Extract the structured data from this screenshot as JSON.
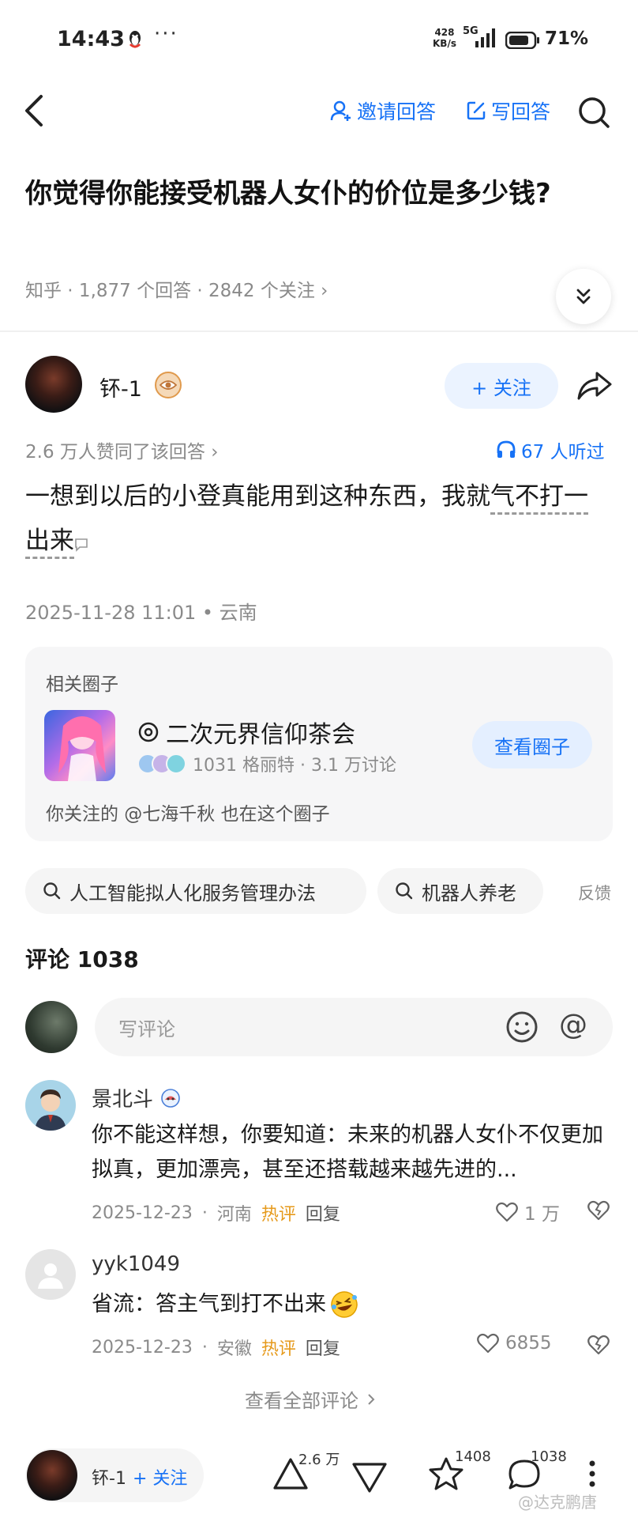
{
  "status_bar": {
    "time": "14:43",
    "more": "···",
    "net_speed_value": "428",
    "net_speed_unit": "KB/s",
    "network": "5G",
    "battery": "71%"
  },
  "nav": {
    "invite_label": "邀请回答",
    "write_label": "写回答"
  },
  "question": {
    "title": "你觉得你能接受机器人女仆的价位是多少钱?",
    "meta": "知乎 · 1,877 个回答 · 2842 个关注 ›"
  },
  "answer": {
    "author_name": "钚-1",
    "follow_label": "+ 关注",
    "votes": "2.6 万人赞同了该回答 ›",
    "listened": "67 人听过",
    "text_part1": "一想到以后的小登真能用到这种东西，我就",
    "text_part2": "气不打一出来",
    "date_location": "2025-11-28 11:01 • 云南"
  },
  "circle": {
    "header": "相关圈子",
    "name": "二次元界信仰茶会",
    "stats": "1031 格丽特 · 3.1 万讨论",
    "view_button": "查看圈子",
    "note": "你关注的 @七海千秋 也在这个圈子"
  },
  "related_searches": [
    {
      "label": "人工智能拟人化服务管理办法"
    },
    {
      "label": "机器人养老"
    }
  ],
  "feedback_label": "反馈",
  "comments": {
    "title": "评论 1038",
    "input_placeholder": "写评论",
    "items": [
      {
        "author": "景北斗",
        "text": "你不能这样想，你要知道：未来的机器人女仆不仅更加拟真，更加漂亮，甚至还搭载越来越先进的...",
        "date": "2025-12-23",
        "location": "河南",
        "hot": "热评",
        "reply": "回复",
        "likes": "1 万"
      },
      {
        "author": "yyk1049",
        "text": "省流：答主气到打不出来",
        "date": "2025-12-23",
        "location": "安徽",
        "hot": "热评",
        "reply": "回复",
        "likes": "6855"
      }
    ],
    "view_all": "查看全部评论"
  },
  "bottom_bar": {
    "author_name": "钚-1",
    "follow_label": "+ 关注",
    "upvotes": "2.6 万",
    "favorites": "1408",
    "comments": "1038"
  },
  "watermark": "@达克鹏唐",
  "colors": {
    "accent": "#1772f6",
    "hot": "#e69a1c",
    "muted": "#8a8a8a"
  }
}
